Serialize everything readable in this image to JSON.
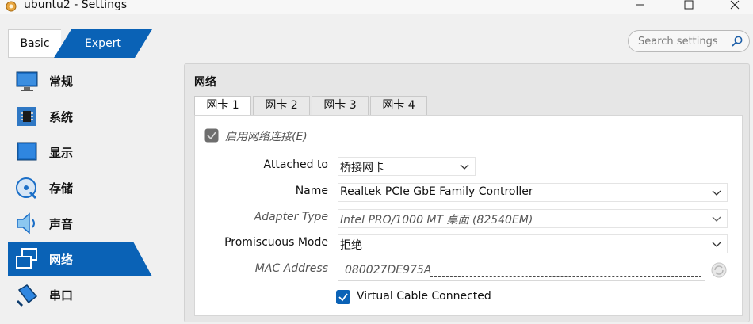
{
  "window": {
    "title": "ubuntu2 - Settings",
    "min_icon": "minimize-icon",
    "max_icon": "maximize-icon",
    "close_icon": "close-icon"
  },
  "mode": {
    "basic": "Basic",
    "expert": "Expert",
    "selected": "Expert"
  },
  "search": {
    "placeholder": "Search settings"
  },
  "sidebar": {
    "items": [
      {
        "label": "常规",
        "icon": "general-monitor-icon"
      },
      {
        "label": "系统",
        "icon": "system-chip-icon"
      },
      {
        "label": "显示",
        "icon": "display-monitor-icon"
      },
      {
        "label": "存储",
        "icon": "storage-disk-icon"
      },
      {
        "label": "声音",
        "icon": "audio-speaker-icon"
      },
      {
        "label": "网络",
        "icon": "network-icon",
        "active": true
      },
      {
        "label": "串口",
        "icon": "serial-port-icon"
      }
    ]
  },
  "network": {
    "section_title": "网络",
    "tabs": [
      "网卡 1",
      "网卡 2",
      "网卡 3",
      "网卡 4"
    ],
    "active_tab": "网卡 1",
    "enable_label": "启用网络连接(E)",
    "attached_to": {
      "label": "Attached to",
      "value": "桥接网卡"
    },
    "name": {
      "label": "Name",
      "value": "Realtek PCIe GbE Family Controller"
    },
    "adapter_type": {
      "label": "Adapter Type",
      "value": "Intel PRO/1000 MT 桌面 (82540EM)"
    },
    "promiscuous": {
      "label": "Promiscuous Mode",
      "value": "拒绝"
    },
    "mac": {
      "label": "MAC Address",
      "value": "080027DE975A"
    },
    "cable": {
      "label": "Virtual Cable Connected",
      "checked": true
    }
  },
  "colors": {
    "accent": "#0a62b6",
    "panel_bg": "#e6e6e6",
    "window_bg": "#f0f0f0"
  }
}
